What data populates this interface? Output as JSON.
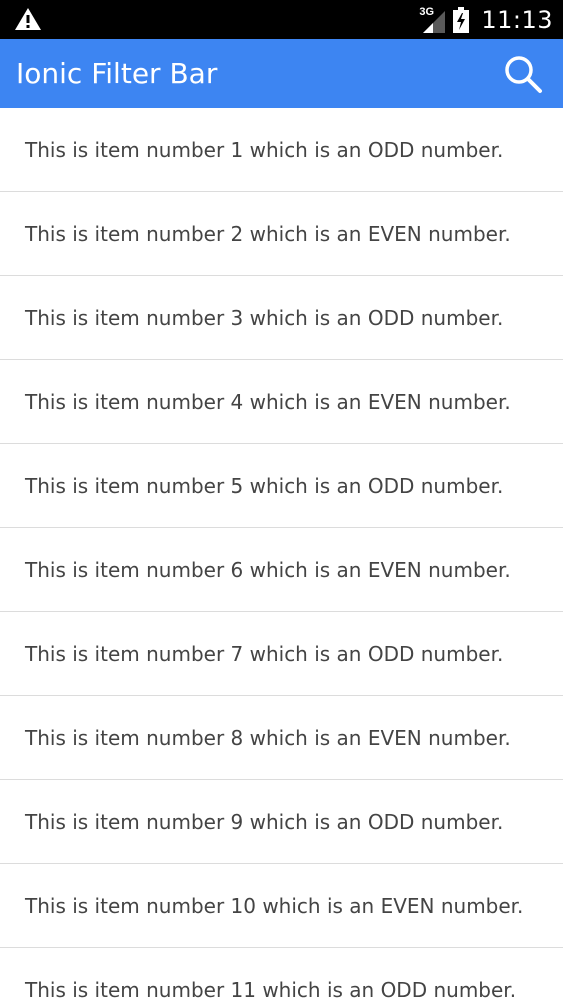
{
  "status_bar": {
    "network": "3G",
    "time": "11:13",
    "icons": [
      "warning-icon",
      "signal-icon",
      "battery-charging-icon"
    ]
  },
  "header": {
    "title": "Ionic Filter Bar",
    "search_icon": "search-icon",
    "accent_color": "#3d85f2"
  },
  "list": {
    "items": [
      {
        "label": "This is item number 1 which is an ODD number."
      },
      {
        "label": "This is item number 2 which is an EVEN number."
      },
      {
        "label": "This is item number 3 which is an ODD number."
      },
      {
        "label": "This is item number 4 which is an EVEN number."
      },
      {
        "label": "This is item number 5 which is an ODD number."
      },
      {
        "label": "This is item number 6 which is an EVEN number."
      },
      {
        "label": "This is item number 7 which is an ODD number."
      },
      {
        "label": "This is item number 8 which is an EVEN number."
      },
      {
        "label": "This is item number 9 which is an ODD number."
      },
      {
        "label": "This is item number 10 which is an EVEN number."
      },
      {
        "label": "This is item number 11 which is an ODD number."
      }
    ]
  }
}
